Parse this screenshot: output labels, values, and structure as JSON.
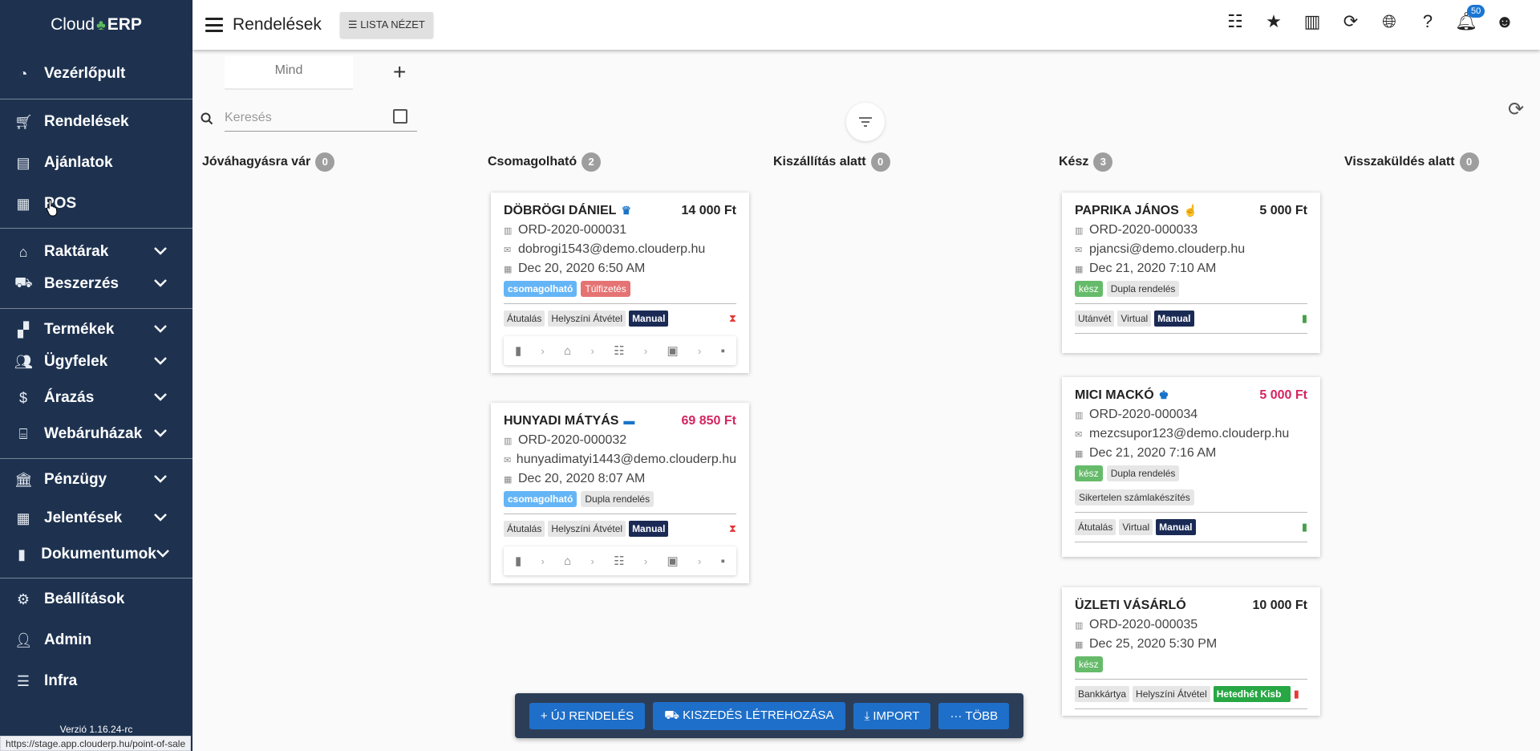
{
  "sidebar": {
    "brand": {
      "left": "Cloud",
      "right": "ERP"
    },
    "items": [
      {
        "label": "Vezérlőpult",
        "icon": "dashboard-icon"
      },
      {
        "label": "Rendelések",
        "icon": "cart-icon"
      },
      {
        "label": "Ajánlatok",
        "icon": "document-icon"
      },
      {
        "label": "POS",
        "icon": "cash-register-icon"
      },
      {
        "label": "Raktárak",
        "icon": "warehouse-icon"
      },
      {
        "label": "Beszerzés",
        "icon": "truck-icon"
      },
      {
        "label": "Termékek",
        "icon": "boxes-icon"
      },
      {
        "label": "Ügyfelek",
        "icon": "users-icon"
      },
      {
        "label": "Árazás",
        "icon": "dollar-icon"
      },
      {
        "label": "Webáruházak",
        "icon": "store-icon"
      },
      {
        "label": "Pénzügy",
        "icon": "bank-icon"
      },
      {
        "label": "Jelentések",
        "icon": "table-icon"
      },
      {
        "label": "Dokumentumok",
        "icon": "file-icon"
      },
      {
        "label": "Beállítások",
        "icon": "gear-icon"
      },
      {
        "label": "Admin",
        "icon": "user-gear-icon"
      },
      {
        "label": "Infra",
        "icon": "server-icon"
      }
    ],
    "version": "Verzió 1.16.24-rc",
    "status_url": "https://stage.app.clouderp.hu/point-of-sale"
  },
  "topbar": {
    "title": "Rendelések",
    "list_view_label": "LISTA NÉZET",
    "notification_count": "50"
  },
  "tabs": {
    "mind": "Mind"
  },
  "search": {
    "placeholder": "Keresés"
  },
  "columns": [
    {
      "title": "Jóváhagyásra vár",
      "count": "0"
    },
    {
      "title": "Csomagolható",
      "count": "2"
    },
    {
      "title": "Kiszállítás alatt",
      "count": "0"
    },
    {
      "title": "Kész",
      "count": "3"
    },
    {
      "title": "Visszaküldés alatt",
      "count": "0"
    }
  ],
  "cards": {
    "c1": {
      "name": "DÖBRÖGI DÁNIEL",
      "amount": "14 000 Ft",
      "order": "ORD-2020-000031",
      "email": "dobrogi1543@demo.clouderp.hu",
      "date": "Dec 20, 2020 6:50 AM",
      "tag1": "csomagolható",
      "tag2": "Túlfizetés",
      "pay": "Átutalás",
      "ship": "Helyszíni Átvétel",
      "source": "Manual"
    },
    "c2": {
      "name": "HUNYADI MÁTYÁS",
      "amount": "69 850 Ft",
      "order": "ORD-2020-000032",
      "email": "hunyadimatyi1443@demo.clouderp.hu",
      "date": "Dec 20, 2020 8:07 AM",
      "tag1": "csomagolható",
      "tag2": "Dupla rendelés",
      "pay": "Átutalás",
      "ship": "Helyszíni Átvétel",
      "source": "Manual"
    },
    "c3": {
      "name": "PAPRIKA JÁNOS",
      "amount": "5 000 Ft",
      "order": "ORD-2020-000033",
      "email": "pjancsi@demo.clouderp.hu",
      "date": "Dec 21, 2020 7:10 AM",
      "tag1": "kész",
      "tag2": "Dupla rendelés",
      "pay": "Utánvét",
      "ship": "Virtual",
      "source": "Manual"
    },
    "c4": {
      "name": "MICI MACKÓ",
      "amount": "5 000 Ft",
      "order": "ORD-2020-000034",
      "email": "mezcsupor123@demo.clouderp.hu",
      "date": "Dec 21, 2020 7:16 AM",
      "tag1": "kész",
      "tag2": "Dupla rendelés",
      "tag3": "Sikertelen számlakészítés",
      "pay": "Átutalás",
      "ship": "Virtual",
      "source": "Manual"
    },
    "c5": {
      "name": "ÜZLETI VÁSÁRLÓ",
      "amount": "10 000 Ft",
      "order": "ORD-2020-000035",
      "date": "Dec 25, 2020 5:30 PM",
      "tag1": "kész",
      "pay": "Bankkártya",
      "ship": "Helyszíni Átvétel",
      "source": "Hetedhét Kisb"
    }
  },
  "actions": {
    "new_order": "ÚJ RENDELÉS",
    "shipment": "KISZEDÉS LÉTREHOZÁSA",
    "import": "IMPORT",
    "more": "TÖBB"
  }
}
